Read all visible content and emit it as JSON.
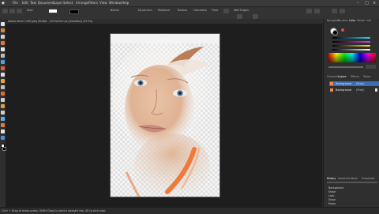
{
  "menubar": {
    "items": [
      "File",
      "Edit",
      "Text",
      "Document",
      "Layer",
      "Select",
      "Arrange",
      "Filters",
      "View",
      "Window",
      "Help"
    ]
  },
  "context_toolbar": {
    "size_label": "Size:",
    "mode_label": "Blend:",
    "controls": [
      "Dynamics",
      "Rotation",
      "Radius",
      "Hardness",
      "Flow",
      "Wet Edges"
    ]
  },
  "document": {
    "tab_title": "Adobe Stock 1165.jpeg (RGB/8 - 1200x2000 px) [Modified] (23.3%)"
  },
  "panels": {
    "top_tabs": [
      "Navigator",
      "Brushes",
      "Color",
      "Stroke",
      "Info"
    ],
    "layers_tabs": [
      "Channels",
      "Layers",
      "Effects",
      "Styles"
    ],
    "layers": [
      {
        "name": "Background",
        "type": "(Pixel)"
      },
      {
        "name": "Background",
        "type": "(Pixel)"
      }
    ],
    "history_tabs": [
      "History",
      "Swatches",
      "Stock",
      "Snapshots"
    ],
    "history_items": [
      "Background",
      "Erase",
      "Lock",
      "Erase",
      "Erase",
      "Erase"
    ]
  },
  "status": {
    "text": "Click + Drag to erase pixels. Shift+Drag to paint a straight line. Alt to pick color."
  }
}
